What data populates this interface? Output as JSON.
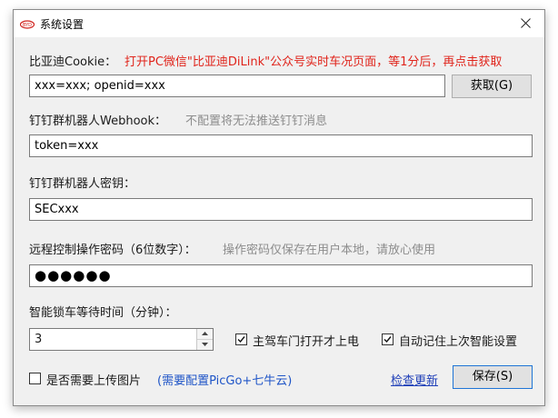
{
  "window": {
    "title": "系统设置"
  },
  "cookie": {
    "label": "比亚迪Cookie：",
    "hint": "打开PC微信\"比亚迪DiLink\"公众号实时车况页面，等1分后，再点击获取",
    "value": "xxx=xxx; openid=xxx",
    "fetch_button": "获取(G)"
  },
  "webhook": {
    "label": "钉钉群机器人Webhook：",
    "hint": "不配置将无法推送钉钉消息",
    "value": "token=xxx"
  },
  "secret": {
    "label": "钉钉群机器人密钥：",
    "value": "SECxxx"
  },
  "remote_password": {
    "label": "远程控制操作密码（6位数字）：",
    "hint": "操作密码仅保存在用户本地，请放心使用",
    "value": "●●●●●●"
  },
  "lock_wait": {
    "label": "智能锁车等待时间（分钟）：",
    "value": "3"
  },
  "options": {
    "driver_door": {
      "label": "主驾车门打开才上电",
      "checked": true
    },
    "remember_smart": {
      "label": "自动记住上次智能设置",
      "checked": true
    },
    "upload_image": {
      "label": "是否需要上传图片",
      "checked": false
    },
    "upload_hint": "(需要配置PicGo+七牛云)"
  },
  "footer": {
    "check_update": "检查更新",
    "save_button": "保存(S)"
  },
  "colors": {
    "hint_red": "#e0241b",
    "hint_gray": "#8c8c8c",
    "hint_blue": "#1f55c7",
    "primary_border": "#1f75d6",
    "window_bg": "#f0f0f0"
  }
}
